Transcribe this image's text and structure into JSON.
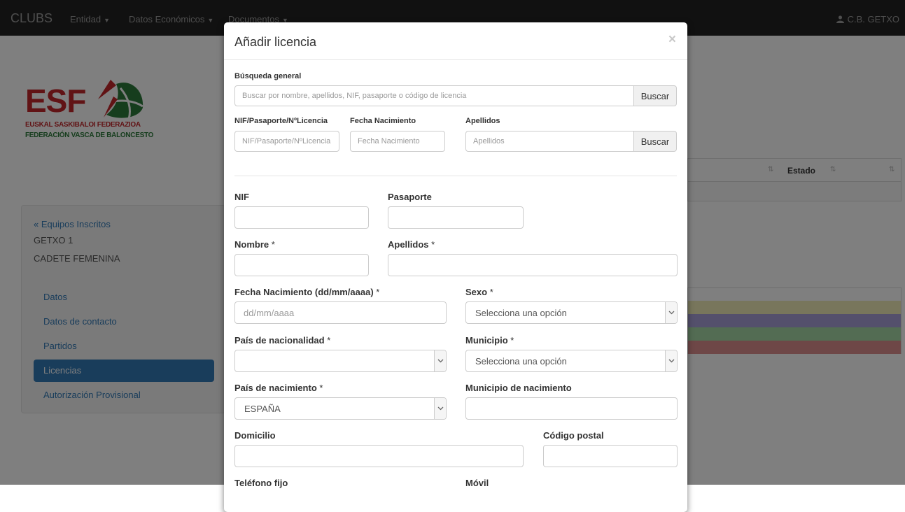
{
  "navbar": {
    "brand": "CLUBS",
    "items": [
      "Entidad",
      "Datos Económicos",
      "Documentos"
    ],
    "user": "C.B. GETXO"
  },
  "logo": {
    "text": "ESF",
    "line1": "EUSKAL SASKIBALOI FEDERAZIOA",
    "line2": "FEDERACIÓN VASCA DE BALONCESTO"
  },
  "sidebar": {
    "back_link": "« Equipos Inscritos",
    "team": "GETXO 1",
    "category": "CADETE FEMENINA",
    "items": [
      {
        "label": "Datos"
      },
      {
        "label": "Datos de contacto"
      },
      {
        "label": "Partidos"
      },
      {
        "label": "Licencias",
        "active": true
      },
      {
        "label": "Autorización Provisional"
      }
    ]
  },
  "background_table": {
    "estado_header": "Estado",
    "legend_colors": [
      "#ffffff",
      "#f0ecb8",
      "#a9a1d8",
      "#a6d8a6",
      "#dd8f8f"
    ]
  },
  "modal": {
    "title": "Añadir licencia",
    "close": "×",
    "search": {
      "general_label": "Búsqueda general",
      "general_placeholder": "Buscar por nombre, apellidos, NIF, pasaporte o código de licencia",
      "button": "Buscar",
      "nif_label": "NIF/Pasaporte/NºLicencia",
      "nif_placeholder": "NIF/Pasaporte/NºLicencia",
      "fecha_label": "Fecha Nacimiento",
      "fecha_placeholder": "Fecha Nacimiento",
      "apellidos_label": "Apellidos",
      "apellidos_placeholder": "Apellidos",
      "button2": "Buscar"
    },
    "form": {
      "nif_label": "NIF",
      "pasaporte_label": "Pasaporte",
      "nombre_label": "Nombre",
      "apellidos_label": "Apellidos",
      "fecha_label": "Fecha Nacimiento (dd/mm/aaaa)",
      "fecha_placeholder": "dd/mm/aaaa",
      "sexo_label": "Sexo",
      "sexo_value": "Selecciona una opción",
      "pais_nac_label": "País de nacionalidad",
      "pais_nac_value": "",
      "municipio_label": "Municipio",
      "municipio_value": "Selecciona una opción",
      "pais_nacimiento_label": "País de nacimiento",
      "pais_nacimiento_value": "ESPAÑA",
      "municipio_nac_label": "Municipio de nacimiento",
      "domicilio_label": "Domicilio",
      "cp_label": "Código postal",
      "telefono_label": "Teléfono fijo",
      "movil_label": "Móvil",
      "required_mark": "*"
    }
  }
}
